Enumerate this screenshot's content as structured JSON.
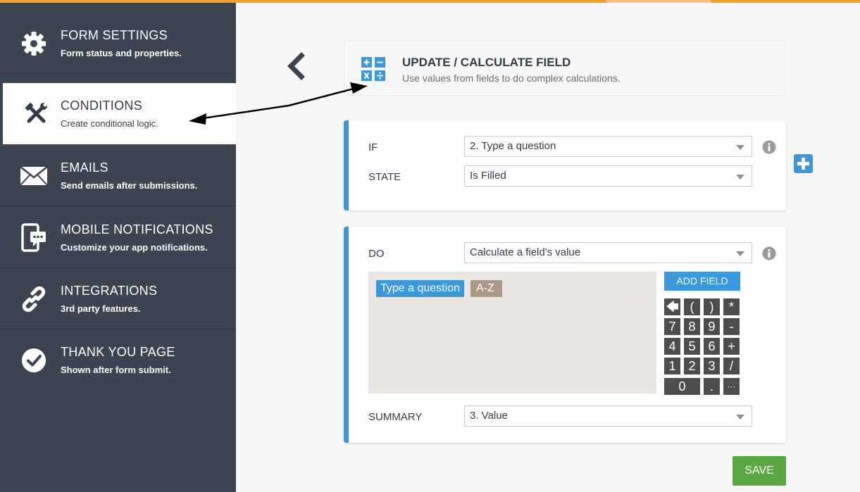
{
  "sidebar": {
    "items": [
      {
        "title": "FORM SETTINGS",
        "subtitle": "Form status and properties.",
        "icon": "gear-icon"
      },
      {
        "title": "CONDITIONS",
        "subtitle": "Create conditional logic.",
        "icon": "tools-icon"
      },
      {
        "title": "EMAILS",
        "subtitle": "Send emails after submissions.",
        "icon": "envelope-icon"
      },
      {
        "title": "MOBILE NOTIFICATIONS",
        "subtitle": "Customize your app notifications.",
        "icon": "mobile-chat-icon"
      },
      {
        "title": "INTEGRATIONS",
        "subtitle": "3rd party features.",
        "icon": "link-icon"
      },
      {
        "title": "THANK YOU PAGE",
        "subtitle": "Shown after form submit.",
        "icon": "check-circle-icon"
      }
    ]
  },
  "header": {
    "title": "UPDATE / CALCULATE FIELD",
    "subtitle": "Use values from fields to do complex calculations.",
    "icon": "calculator-icon"
  },
  "condition": {
    "if_label": "IF",
    "if_value": "2. Type a question",
    "state_label": "STATE",
    "state_value": "Is Filled"
  },
  "action": {
    "do_label": "DO",
    "do_value": "Calculate a field's value",
    "token_field": "Type a question",
    "token_az": "A-Z",
    "add_field_label": "ADD FIELD",
    "summary_label": "SUMMARY",
    "summary_value": "3. Value"
  },
  "keypad": {
    "row1": [
      "🡄",
      "(",
      ")",
      "*"
    ],
    "row2": [
      "7",
      "8",
      "9",
      "-"
    ],
    "row3": [
      "4",
      "5",
      "6",
      "+"
    ],
    "row4": [
      "1",
      "2",
      "3",
      "/"
    ],
    "row5": [
      "0",
      ".",
      "···"
    ]
  },
  "save_label": "SAVE",
  "colors": {
    "accent": "#3a99dc",
    "sidebar": "#3c4351",
    "topbar": "#f59f2b",
    "save": "#59a844",
    "key": "#4d4d4d"
  }
}
